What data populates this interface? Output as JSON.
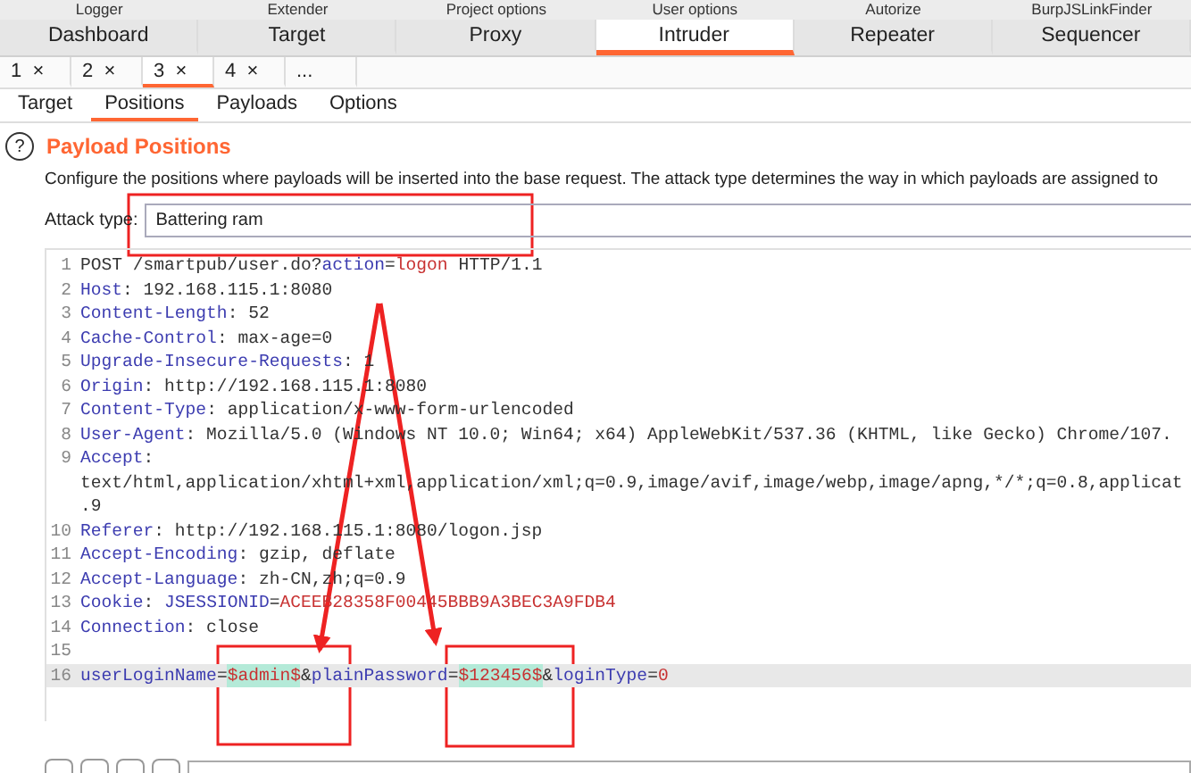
{
  "top_tabs": [
    {
      "label": "Logger"
    },
    {
      "label": "Extender"
    },
    {
      "label": "Project options"
    },
    {
      "label": "User options"
    },
    {
      "label": "Autorize"
    },
    {
      "label": "BurpJSLinkFinder"
    }
  ],
  "main_tabs": [
    {
      "label": "Dashboard",
      "selected": false
    },
    {
      "label": "Target",
      "selected": false
    },
    {
      "label": "Proxy",
      "selected": false
    },
    {
      "label": "Intruder",
      "selected": true
    },
    {
      "label": "Repeater",
      "selected": false
    },
    {
      "label": "Sequencer",
      "selected": false
    }
  ],
  "attack_tabs": [
    {
      "label": "1",
      "close": "×",
      "selected": false
    },
    {
      "label": "2",
      "close": "×",
      "selected": false
    },
    {
      "label": "3",
      "close": "×",
      "selected": true
    },
    {
      "label": "4",
      "close": "×",
      "selected": false
    },
    {
      "label": "...",
      "selected": false
    }
  ],
  "sub_tabs": [
    {
      "label": "Target",
      "selected": false
    },
    {
      "label": "Positions",
      "selected": true
    },
    {
      "label": "Payloads",
      "selected": false
    },
    {
      "label": "Options",
      "selected": false
    }
  ],
  "section": {
    "help": "?",
    "title": "Payload Positions",
    "description": "Configure the positions where payloads will be inserted into the base request. The attack type determines the way in which payloads are assigned to"
  },
  "attack_type": {
    "label": "Attack type:",
    "value": "Battering ram"
  },
  "request_lines": [
    {
      "number": "1",
      "segments": [
        {
          "kind": "plain",
          "text": "POST /smartpub/user.do?"
        },
        {
          "kind": "param",
          "text": "action"
        },
        {
          "kind": "plain",
          "text": "="
        },
        {
          "kind": "value",
          "text": "logon"
        },
        {
          "kind": "plain",
          "text": " HTTP/1.1"
        }
      ]
    },
    {
      "number": "2",
      "segments": [
        {
          "kind": "param",
          "text": "Host"
        },
        {
          "kind": "plain",
          "text": ": 192.168.115.1:8080"
        }
      ]
    },
    {
      "number": "3",
      "segments": [
        {
          "kind": "param",
          "text": "Content-Length"
        },
        {
          "kind": "plain",
          "text": ": 52"
        }
      ]
    },
    {
      "number": "4",
      "segments": [
        {
          "kind": "param",
          "text": "Cache-Control"
        },
        {
          "kind": "plain",
          "text": ": max-age=0"
        }
      ]
    },
    {
      "number": "5",
      "segments": [
        {
          "kind": "param",
          "text": "Upgrade-Insecure-Requests"
        },
        {
          "kind": "plain",
          "text": ": 1"
        }
      ]
    },
    {
      "number": "6",
      "segments": [
        {
          "kind": "param",
          "text": "Origin"
        },
        {
          "kind": "plain",
          "text": ": http://192.168.115.1:8080"
        }
      ]
    },
    {
      "number": "7",
      "segments": [
        {
          "kind": "param",
          "text": "Content-Type"
        },
        {
          "kind": "plain",
          "text": ": application/x-www-form-urlencoded"
        }
      ]
    },
    {
      "number": "8",
      "segments": [
        {
          "kind": "param",
          "text": "User-Agent"
        },
        {
          "kind": "plain",
          "text": ": Mozilla/5.0 (Windows NT 10.0; Win64; x64) AppleWebKit/537.36 (KHTML, like Gecko) Chrome/107."
        }
      ]
    },
    {
      "number": "9",
      "segments": [
        {
          "kind": "param",
          "text": "Accept"
        },
        {
          "kind": "plain",
          "text": ":"
        }
      ]
    },
    {
      "segments": [
        {
          "kind": "plain",
          "text": "text/html,application/xhtml+xml,application/xml;q=0.9,image/avif,image/webp,image/apng,*/*;q=0.8,applicat"
        }
      ]
    },
    {
      "segments": [
        {
          "kind": "plain",
          "text": ".9"
        }
      ]
    },
    {
      "number": "10",
      "segments": [
        {
          "kind": "param",
          "text": "Referer"
        },
        {
          "kind": "plain",
          "text": ": http://192.168.115.1:8080/logon.jsp"
        }
      ]
    },
    {
      "number": "11",
      "segments": [
        {
          "kind": "param",
          "text": "Accept-Encoding"
        },
        {
          "kind": "plain",
          "text": ": gzip, deflate"
        }
      ]
    },
    {
      "number": "12",
      "segments": [
        {
          "kind": "param",
          "text": "Accept-Language"
        },
        {
          "kind": "plain",
          "text": ": zh-CN,zh;q=0.9"
        }
      ]
    },
    {
      "number": "13",
      "segments": [
        {
          "kind": "param",
          "text": "Cookie"
        },
        {
          "kind": "plain",
          "text": ": "
        },
        {
          "kind": "param",
          "text": "JSESSIONID"
        },
        {
          "kind": "plain",
          "text": "="
        },
        {
          "kind": "value",
          "text": "ACEEB28358F00445BBB9A3BEC3A9FDB4"
        }
      ]
    },
    {
      "number": "14",
      "segments": [
        {
          "kind": "param",
          "text": "Connection"
        },
        {
          "kind": "plain",
          "text": ": close"
        }
      ]
    },
    {
      "number": "15"
    },
    {
      "number": "16",
      "current": true,
      "segments": [
        {
          "kind": "param",
          "text": "userLoginName"
        },
        {
          "kind": "plain",
          "text": "="
        },
        {
          "kind": "payload",
          "text": "$admin$"
        },
        {
          "kind": "plain",
          "text": "&"
        },
        {
          "kind": "param",
          "text": "plainPassword"
        },
        {
          "kind": "plain",
          "text": "="
        },
        {
          "kind": "payload",
          "text": "$123456$"
        },
        {
          "kind": "plain",
          "text": "&"
        },
        {
          "kind": "param",
          "text": "loginType"
        },
        {
          "kind": "plain",
          "text": "="
        },
        {
          "kind": "value",
          "text": "0"
        }
      ]
    }
  ]
}
